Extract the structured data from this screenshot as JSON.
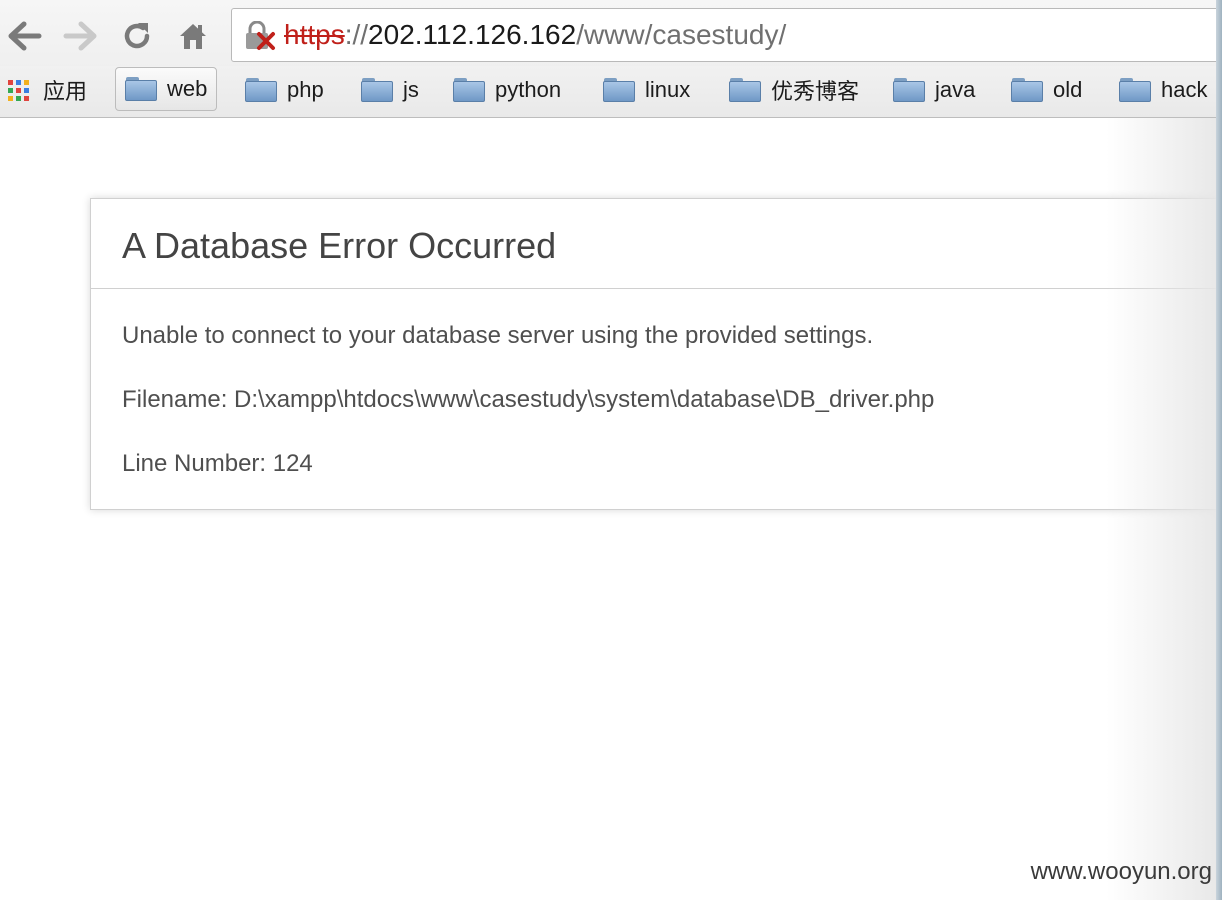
{
  "address_bar": {
    "scheme": "https",
    "separator": "://",
    "host": "202.112.126.162",
    "path": "/www/casestudy/",
    "security_status": "broken-https"
  },
  "toolbar": {
    "back_icon": "arrow-left-icon",
    "forward_icon": "arrow-right-icon",
    "reload_icon": "reload-icon",
    "home_icon": "home-icon"
  },
  "bookmarks": {
    "apps_label": "应用",
    "items": [
      {
        "label": "web",
        "active": true
      },
      {
        "label": "php"
      },
      {
        "label": "js"
      },
      {
        "label": "python"
      },
      {
        "label": "linux"
      },
      {
        "label": "优秀博客"
      },
      {
        "label": "java"
      },
      {
        "label": "old"
      },
      {
        "label": "hack"
      }
    ]
  },
  "error": {
    "title": "A Database Error Occurred",
    "message": "Unable to connect to your database server using the provided settings.",
    "filename": "Filename: D:\\xampp\\htdocs\\www\\casestudy\\system\\database\\DB_driver.php",
    "line_number": "Line Number: 124"
  },
  "watermark": "www.wooyun.org",
  "colors": {
    "scheme_error": "#c0201a",
    "folder": "#7fa3cc",
    "text": "#4f4f4f"
  }
}
